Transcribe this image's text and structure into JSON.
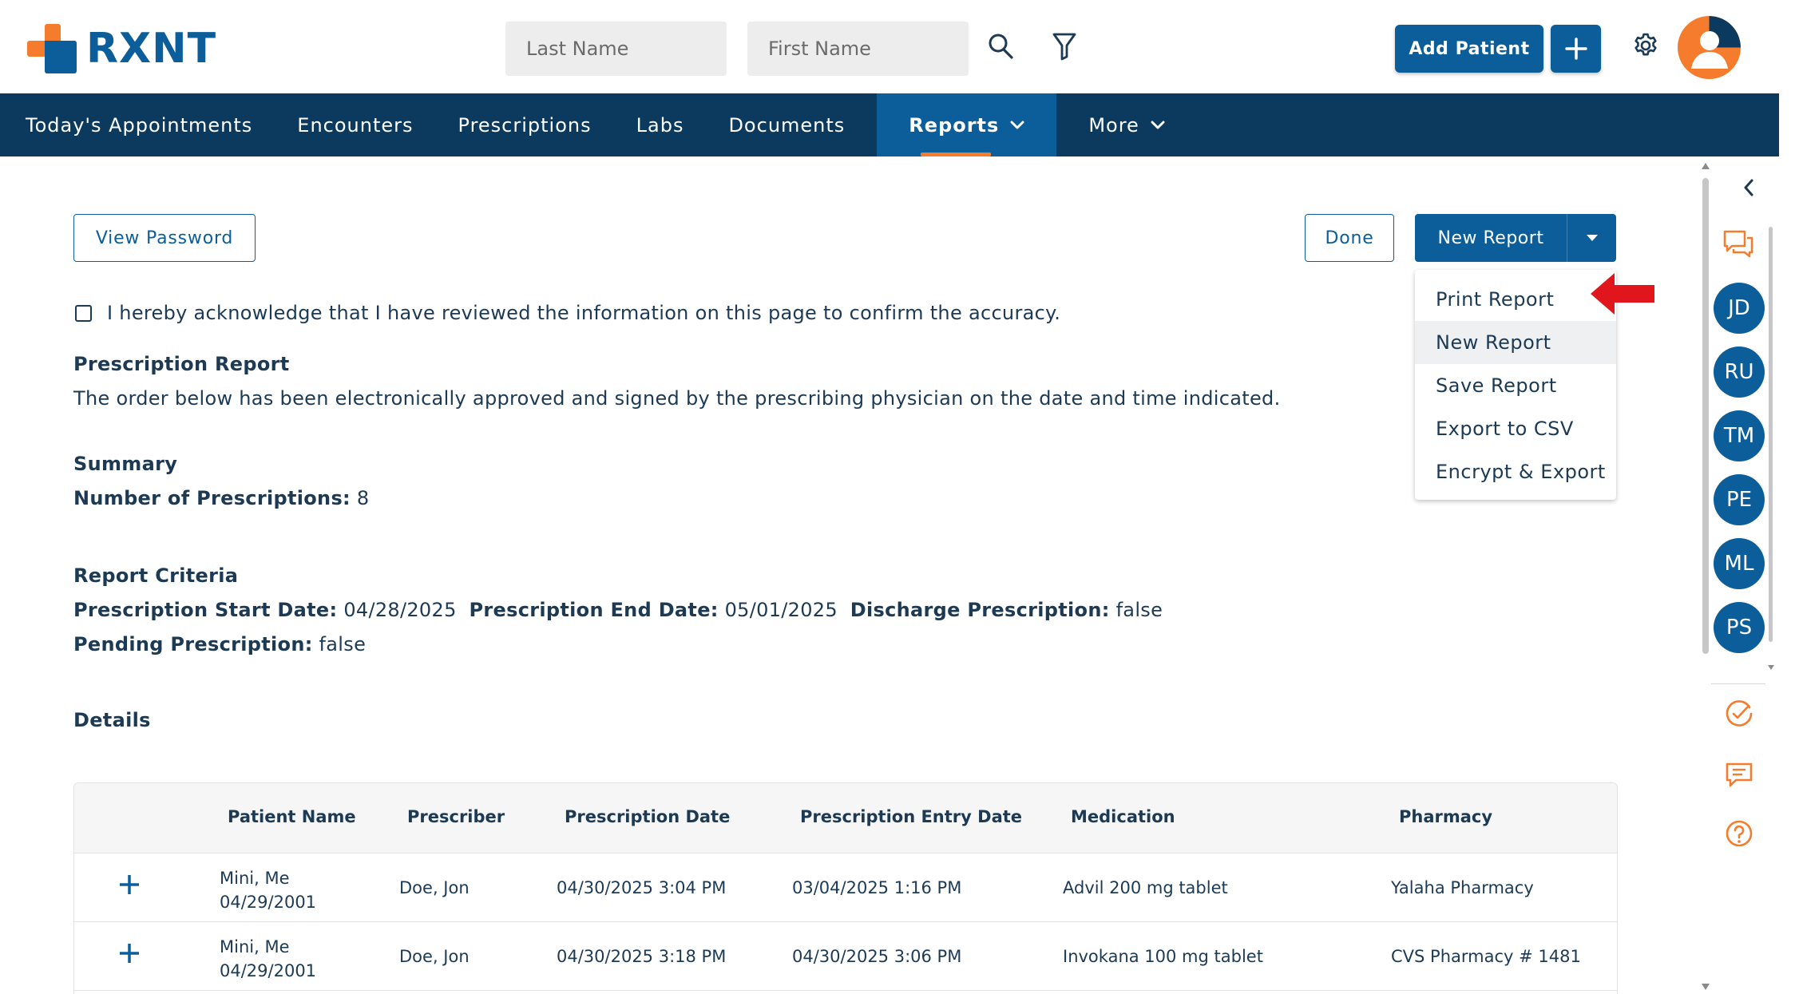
{
  "brand": {
    "name": "RXNT",
    "orange": "#f47c2c",
    "blue": "#0b5e9a",
    "navy": "#0b3a5e"
  },
  "header": {
    "last_name_placeholder": "Last Name",
    "first_name_placeholder": "First Name",
    "search_icon": "search-icon",
    "filter_icon": "filter-icon",
    "add_patient_label": "Add Patient",
    "add_icon": "plus-icon",
    "settings_icon": "gear-icon",
    "avatar_icon": "user-avatar-icon"
  },
  "nav": {
    "items": [
      {
        "label": "Today's Appointments"
      },
      {
        "label": "Encounters"
      },
      {
        "label": "Prescriptions"
      },
      {
        "label": "Labs"
      },
      {
        "label": "Documents"
      },
      {
        "label": "Reports",
        "active": true
      },
      {
        "label": "More"
      }
    ]
  },
  "toolbar": {
    "view_password": "View Password",
    "done": "Done",
    "new_report": "New Report"
  },
  "dropdown": {
    "items": [
      {
        "label": "Print Report"
      },
      {
        "label": "New Report",
        "hover": true
      },
      {
        "label": "Save Report"
      },
      {
        "label": "Export to CSV"
      },
      {
        "label": "Encrypt & Export"
      }
    ],
    "pointer_color": "#e0161c"
  },
  "acknowledge": "I hereby acknowledge that I have reviewed the information on this page to confirm the accuracy.",
  "report": {
    "title": "Prescription Report",
    "subtitle": "The order below has been electronically approved and signed by the prescribing physician on the date and time indicated.",
    "summary_heading": "Summary",
    "num_rx_label": "Number of Prescriptions:",
    "num_rx_value": "8",
    "criteria_heading": "Report Criteria",
    "start_label": "Prescription Start Date:",
    "start_value": "04/28/2025",
    "end_label": "Prescription End Date:",
    "end_value": "05/01/2025",
    "discharge_label": "Discharge Prescription:",
    "discharge_value": "false",
    "pending_label": "Pending Prescription:",
    "pending_value": "false",
    "details_heading": "Details"
  },
  "table": {
    "columns": [
      "Patient Name",
      "Prescriber",
      "Prescription Date",
      "Prescription Entry Date",
      "Medication",
      "Pharmacy"
    ],
    "rows": [
      {
        "patient": "Mini, Me",
        "dob": "04/29/2001",
        "prescriber": "Doe, Jon",
        "rx_date": "04/30/2025 3:04 PM",
        "entry_date": "03/04/2025 1:16 PM",
        "medication": "Advil 200 mg tablet",
        "pharmacy": "Yalaha Pharmacy"
      },
      {
        "patient": "Mini, Me",
        "dob": "04/29/2001",
        "prescriber": "Doe, Jon",
        "rx_date": "04/30/2025 3:18 PM",
        "entry_date": "04/30/2025 3:06 PM",
        "medication": "Invokana 100 mg tablet",
        "pharmacy": "CVS Pharmacy # 1481"
      }
    ]
  },
  "rail": {
    "collapse_icon": "chevron-left-icon",
    "chat_icon": "chat-bubbles-icon",
    "users": [
      "JD",
      "RU",
      "TM",
      "PE",
      "ML",
      "PS"
    ],
    "tasks_icon": "check-circle-icon",
    "message_icon": "message-icon",
    "help_icon": "help-circle-icon"
  }
}
